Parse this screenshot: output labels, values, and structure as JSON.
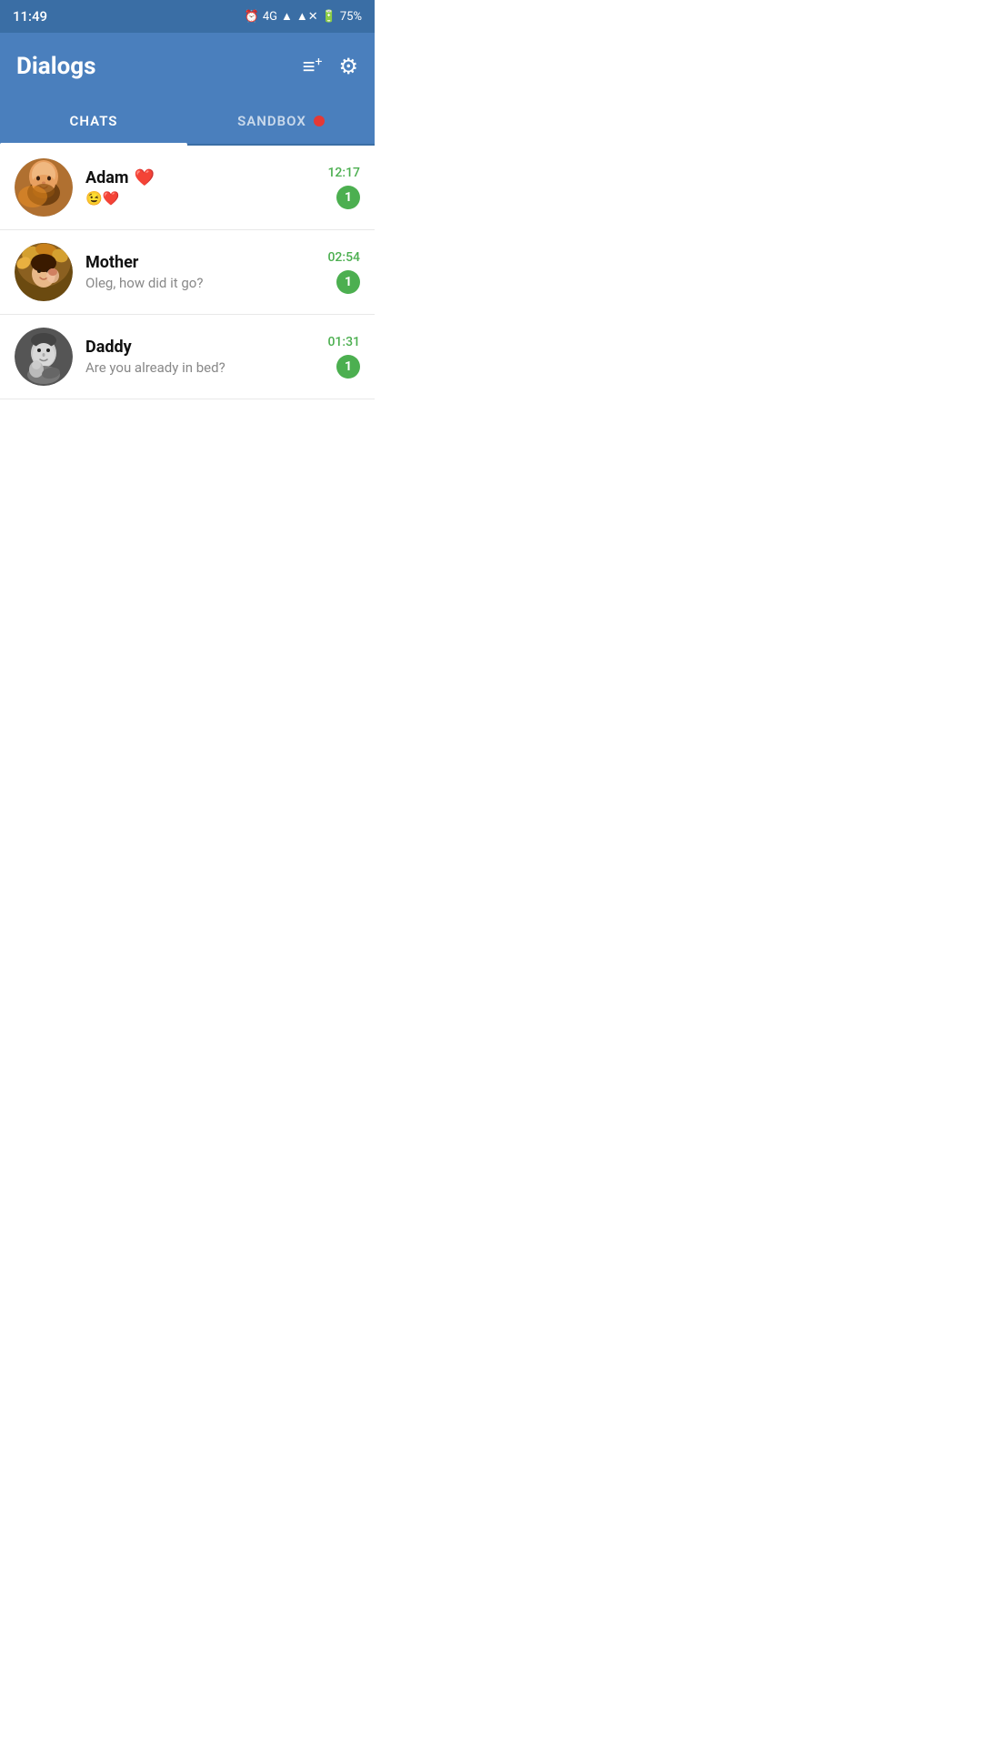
{
  "statusBar": {
    "time": "11:49",
    "networkType": "4G",
    "battery": "75%"
  },
  "header": {
    "title": "Dialogs",
    "addIcon": "≡+",
    "settingsIcon": "⚙"
  },
  "tabs": [
    {
      "id": "chats",
      "label": "CHATS",
      "active": true
    },
    {
      "id": "sandbox",
      "label": "SANDBOX",
      "active": false,
      "hasDot": true
    }
  ],
  "chats": [
    {
      "id": "adam",
      "name": "Adam",
      "nameEmoji": "❤️",
      "preview": "😉❤️",
      "time": "12:17",
      "unread": 1
    },
    {
      "id": "mother",
      "name": "Mother",
      "preview": "Oleg, how did it go?",
      "time": "02:54",
      "unread": 1
    },
    {
      "id": "daddy",
      "name": "Daddy",
      "preview": "Are you already in bed?",
      "time": "01:31",
      "unread": 1
    }
  ]
}
